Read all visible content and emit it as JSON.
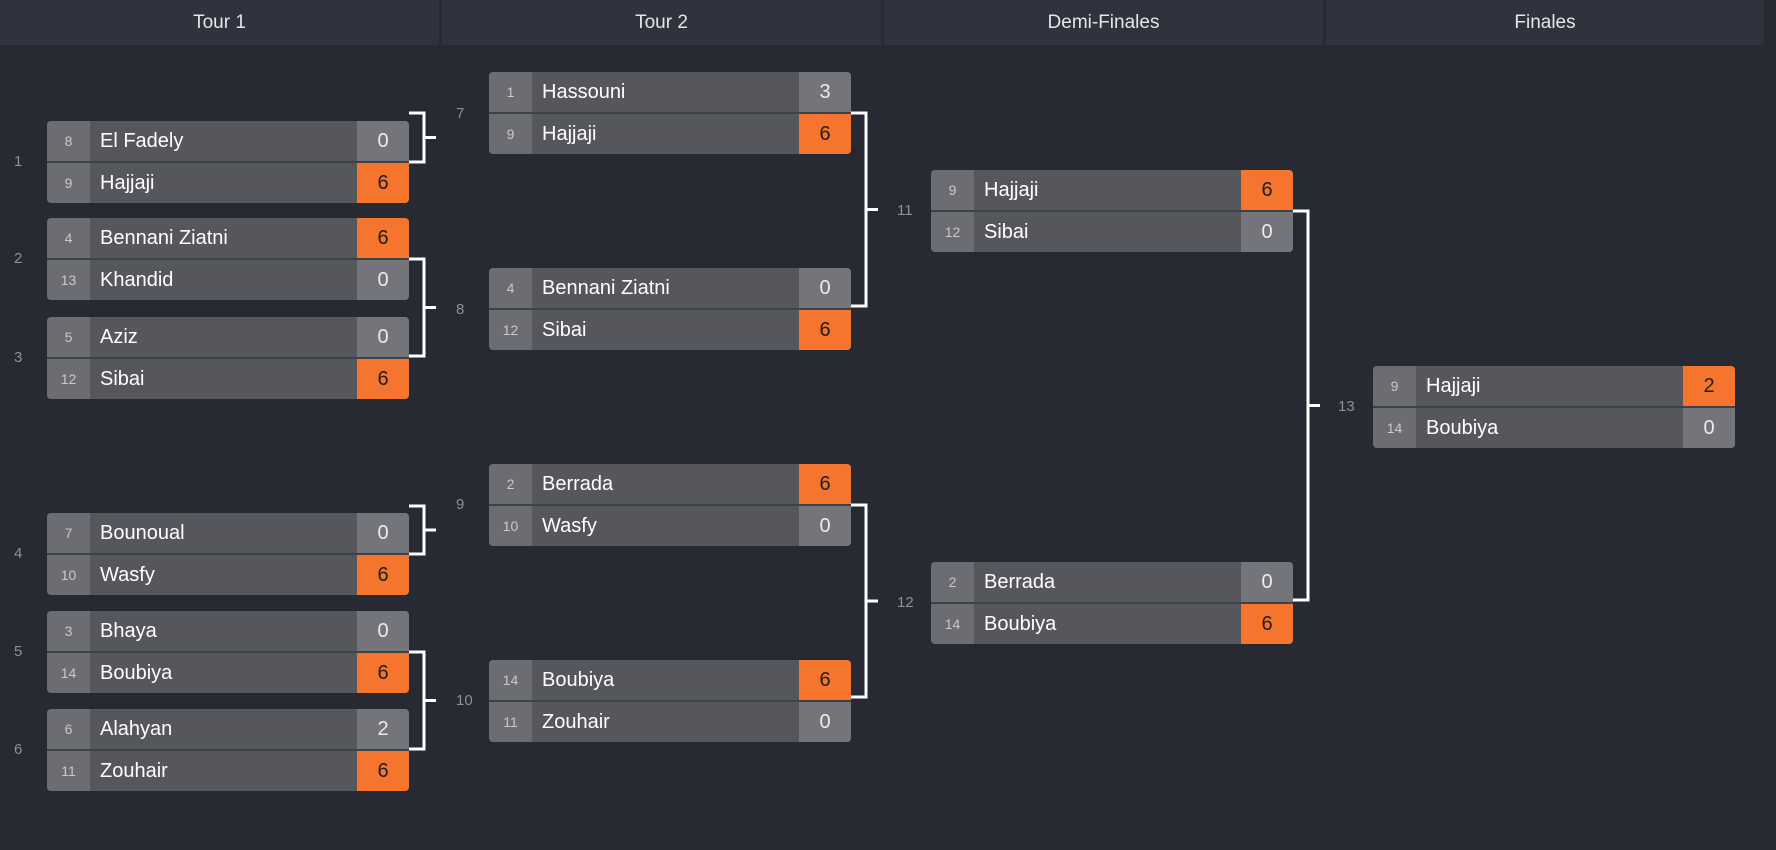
{
  "rounds": [
    "Tour 1",
    "Tour 2",
    "Demi-Finales",
    "Finales"
  ],
  "colors": {
    "background": "#272a33",
    "header": "#30333d",
    "team_row": "#55575d",
    "seed_box": "#6b6d73",
    "score_box": "#73757b",
    "winner_score": "#f5742e",
    "connector": "#ffffff"
  },
  "matches": [
    {
      "num": "1",
      "round": 0,
      "teams": [
        {
          "seed": "8",
          "name": "El Fadely",
          "score": "0",
          "win": false
        },
        {
          "seed": "9",
          "name": "Hajjaji",
          "score": "6",
          "win": true
        }
      ]
    },
    {
      "num": "2",
      "round": 0,
      "teams": [
        {
          "seed": "4",
          "name": "Bennani Ziatni",
          "score": "6",
          "win": true
        },
        {
          "seed": "13",
          "name": "Khandid",
          "score": "0",
          "win": false
        }
      ]
    },
    {
      "num": "3",
      "round": 0,
      "teams": [
        {
          "seed": "5",
          "name": "Aziz",
          "score": "0",
          "win": false
        },
        {
          "seed": "12",
          "name": "Sibai",
          "score": "6",
          "win": true
        }
      ]
    },
    {
      "num": "4",
      "round": 0,
      "teams": [
        {
          "seed": "7",
          "name": "Bounoual",
          "score": "0",
          "win": false
        },
        {
          "seed": "10",
          "name": "Wasfy",
          "score": "6",
          "win": true
        }
      ]
    },
    {
      "num": "5",
      "round": 0,
      "teams": [
        {
          "seed": "3",
          "name": "Bhaya",
          "score": "0",
          "win": false
        },
        {
          "seed": "14",
          "name": "Boubiya",
          "score": "6",
          "win": true
        }
      ]
    },
    {
      "num": "6",
      "round": 0,
      "teams": [
        {
          "seed": "6",
          "name": "Alahyan",
          "score": "2",
          "win": false
        },
        {
          "seed": "11",
          "name": "Zouhair",
          "score": "6",
          "win": true
        }
      ]
    },
    {
      "num": "7",
      "round": 1,
      "teams": [
        {
          "seed": "1",
          "name": "Hassouni",
          "score": "3",
          "win": false
        },
        {
          "seed": "9",
          "name": "Hajjaji",
          "score": "6",
          "win": true
        }
      ]
    },
    {
      "num": "8",
      "round": 1,
      "teams": [
        {
          "seed": "4",
          "name": "Bennani Ziatni",
          "score": "0",
          "win": false
        },
        {
          "seed": "12",
          "name": "Sibai",
          "score": "6",
          "win": true
        }
      ]
    },
    {
      "num": "9",
      "round": 1,
      "teams": [
        {
          "seed": "2",
          "name": "Berrada",
          "score": "6",
          "win": true
        },
        {
          "seed": "10",
          "name": "Wasfy",
          "score": "0",
          "win": false
        }
      ]
    },
    {
      "num": "10",
      "round": 1,
      "teams": [
        {
          "seed": "14",
          "name": "Boubiya",
          "score": "6",
          "win": true
        },
        {
          "seed": "11",
          "name": "Zouhair",
          "score": "0",
          "win": false
        }
      ]
    },
    {
      "num": "11",
      "round": 2,
      "teams": [
        {
          "seed": "9",
          "name": "Hajjaji",
          "score": "6",
          "win": true
        },
        {
          "seed": "12",
          "name": "Sibai",
          "score": "0",
          "win": false
        }
      ]
    },
    {
      "num": "12",
      "round": 2,
      "teams": [
        {
          "seed": "2",
          "name": "Berrada",
          "score": "0",
          "win": false
        },
        {
          "seed": "14",
          "name": "Boubiya",
          "score": "6",
          "win": true
        }
      ]
    },
    {
      "num": "13",
      "round": 3,
      "teams": [
        {
          "seed": "9",
          "name": "Hajjaji",
          "score": "2",
          "win": true
        },
        {
          "seed": "14",
          "name": "Boubiya",
          "score": "0",
          "win": false
        }
      ]
    }
  ]
}
